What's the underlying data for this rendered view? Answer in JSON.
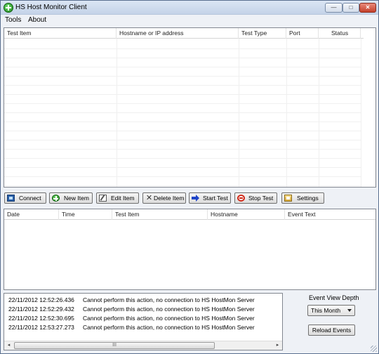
{
  "window": {
    "title": "HS Host Monitor Client",
    "controls": {
      "minimize": "—",
      "maximize": "□",
      "close": "✕"
    }
  },
  "menu": [
    "Tools",
    "About"
  ],
  "test_grid": {
    "columns": [
      "Test Item",
      "Hostname or IP address",
      "Test Type",
      "Port",
      "Status"
    ],
    "rows": []
  },
  "toolbar": [
    {
      "label": "Connect",
      "icon": "connect-icon"
    },
    {
      "label": "New Item",
      "icon": "plus-circle-icon"
    },
    {
      "label": "Edit Item",
      "icon": "edit-icon"
    },
    {
      "label": "Delete Item",
      "icon": "delete-x-icon"
    },
    {
      "label": "Start Test",
      "icon": "arrow-right-icon"
    },
    {
      "label": "Stop Test",
      "icon": "stop-icon"
    },
    {
      "label": "Settings",
      "icon": "settings-icon"
    }
  ],
  "event_grid": {
    "columns": [
      "Date",
      "Time",
      "Test Item",
      "Hostname",
      "Event Text"
    ],
    "rows": []
  },
  "log": [
    {
      "timestamp": "22/11/2012 12:52:26.436",
      "message": "Cannot perform this action, no connection to HS HostMon Server"
    },
    {
      "timestamp": "22/11/2012 12:52:29.432",
      "message": "Cannot perform this action, no connection to HS HostMon Server"
    },
    {
      "timestamp": "22/11/2012 12:52:30.695",
      "message": "Cannot perform this action, no connection to HS HostMon Server"
    },
    {
      "timestamp": "22/11/2012 12:53:27.273",
      "message": "Cannot perform this action, no connection to HS HostMon Server"
    }
  ],
  "log_scrollbar": {
    "left_arrow": "◂",
    "thumb_grip": "III",
    "right_arrow": "▸"
  },
  "event_view": {
    "label": "Event View Depth",
    "selected": "This Month",
    "reload_label": "Reload Events"
  }
}
